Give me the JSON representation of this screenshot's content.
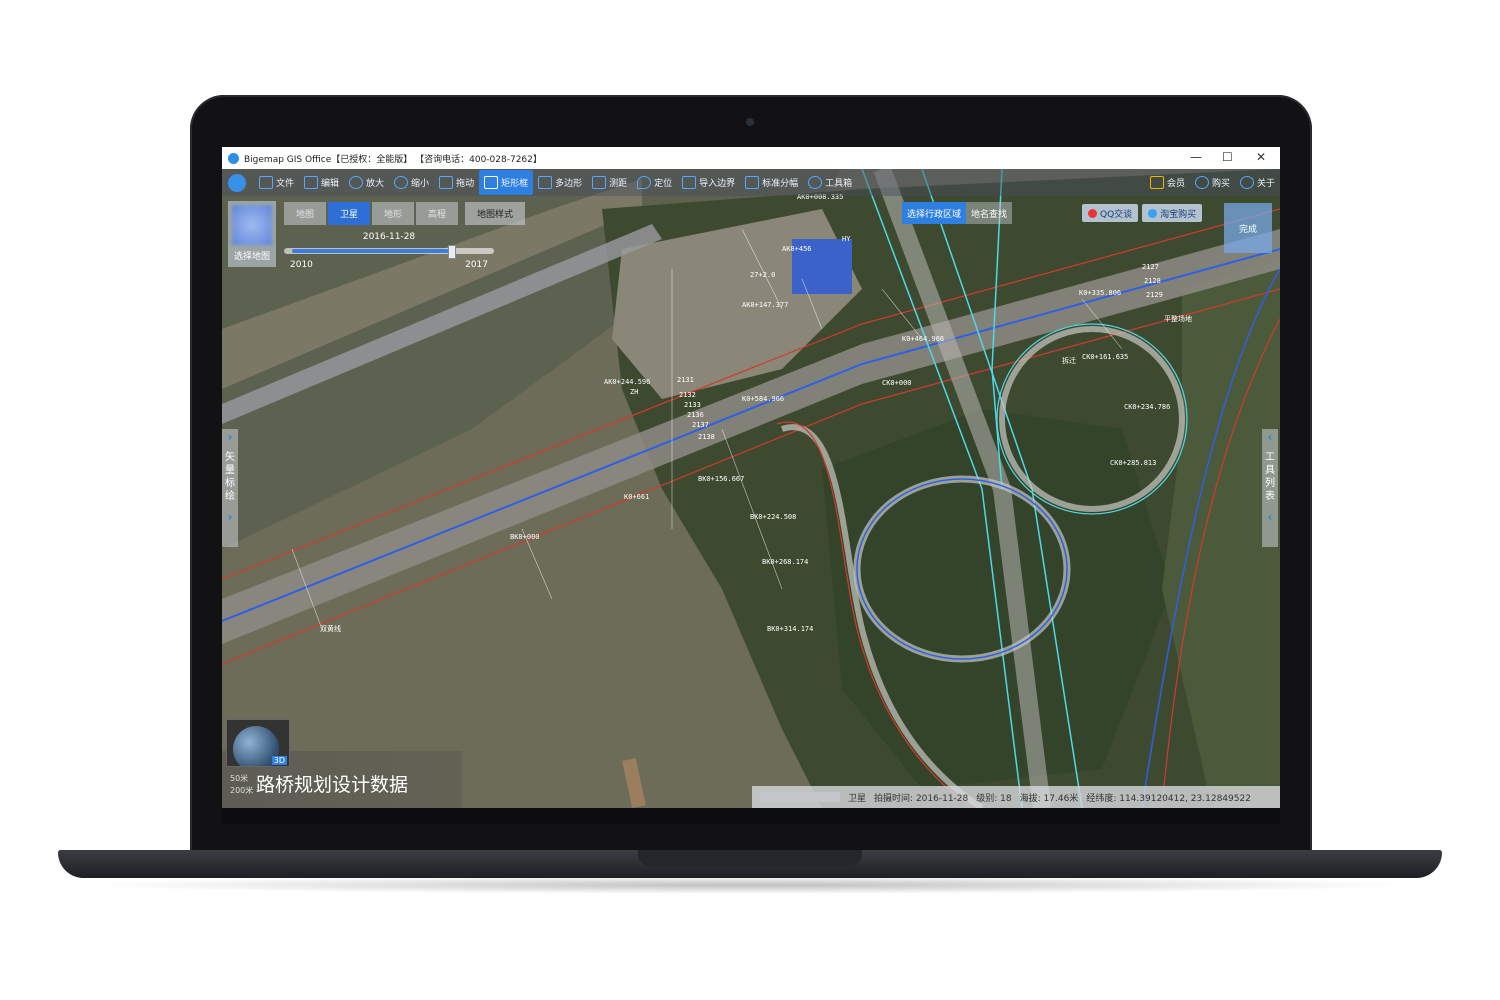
{
  "window": {
    "title": "Bigemap GIS Office【已授权：全能版】 【咨询电话：400-028-7262】",
    "controls": {
      "minimize": "—",
      "maximize": "☐",
      "close": "✕"
    }
  },
  "toolbar": {
    "items": [
      {
        "label": "文件",
        "icon": "folder-icon"
      },
      {
        "label": "编辑",
        "icon": "edit-icon"
      },
      {
        "label": "放大",
        "icon": "zoom-in-icon"
      },
      {
        "label": "缩小",
        "icon": "zoom-out-icon"
      },
      {
        "label": "拖动",
        "icon": "hand-icon"
      },
      {
        "label": "矩形框",
        "icon": "rectangle-icon",
        "active": true
      },
      {
        "label": "多边形",
        "icon": "polygon-icon"
      },
      {
        "label": "测距",
        "icon": "measure-icon"
      },
      {
        "label": "定位",
        "icon": "pin-icon"
      },
      {
        "label": "导入边界",
        "icon": "import-icon"
      },
      {
        "label": "标准分幅",
        "icon": "grid-icon"
      },
      {
        "label": "工具箱",
        "icon": "gear-icon"
      }
    ],
    "right_items": [
      {
        "label": "会员",
        "icon": "vip-icon"
      },
      {
        "label": "购买",
        "icon": "cart-icon"
      },
      {
        "label": "关于",
        "icon": "info-icon"
      }
    ]
  },
  "map_selector": {
    "label": "选择地图"
  },
  "map_types": [
    {
      "label": "地图",
      "active": false
    },
    {
      "label": "卫星",
      "active": true
    },
    {
      "label": "地形",
      "active": false
    },
    {
      "label": "高程",
      "active": false
    }
  ],
  "map_style_button": "地图样式",
  "timeline": {
    "date": "2016-11-28",
    "start_year": "2010",
    "end_year": "2017",
    "position": 0.82
  },
  "region_tabs": [
    {
      "label": "选择行政区域",
      "active": true
    },
    {
      "label": "地名查找",
      "active": false
    }
  ],
  "qq_button": "QQ交谈",
  "taobao_button": "淘宝购买",
  "finish_button": "完成",
  "left_panel": {
    "label": "矢量标绘",
    "chevron_top": "›",
    "chevron_bottom": "›"
  },
  "right_panel": {
    "label": "工具列表",
    "chevron_top": "‹",
    "chevron_bottom": "‹"
  },
  "globe_3d": "3D",
  "caption": {
    "text": "路桥规划设计数据",
    "scale_1": "50米",
    "scale_2": "200米"
  },
  "status_bar": {
    "map_type": "卫星",
    "capture_time_label": "拍摄时间:",
    "capture_time": "2016-11-28",
    "level_label": "级别:",
    "level": "18",
    "elevation_label": "海拔:",
    "elevation": "17.46米",
    "coords_label": "经纬度:",
    "coords": "114.39120412, 23.12849522"
  },
  "annotations": [
    "AK0+008.335",
    "AK0+456",
    "HY",
    "27+2.0",
    "AK0+147.377",
    "AK0+244.596",
    "ZH",
    "K0+584.966",
    "K0+464.966",
    "CK0+000",
    "K0+335.806",
    "CK0+161.635",
    "CK0+234.786",
    "CK0+285.813",
    "K0+661",
    "BK0+156.667",
    "BK0+224.508",
    "BK0+268.174",
    "BK0+314.174",
    "BK0+000",
    "双黄线",
    "平整场地",
    "拆迁",
    "2127",
    "2128",
    "2129",
    "2131",
    "2132",
    "2133",
    "2136",
    "2137",
    "2138"
  ],
  "colors": {
    "accent": "#2d7fe0",
    "road_cyan": "#4fd8e6",
    "road_red": "#d23a2e",
    "road_blue": "#2f5fe6",
    "water": "#6f6e56",
    "vegetation": "#3b4a2c"
  }
}
